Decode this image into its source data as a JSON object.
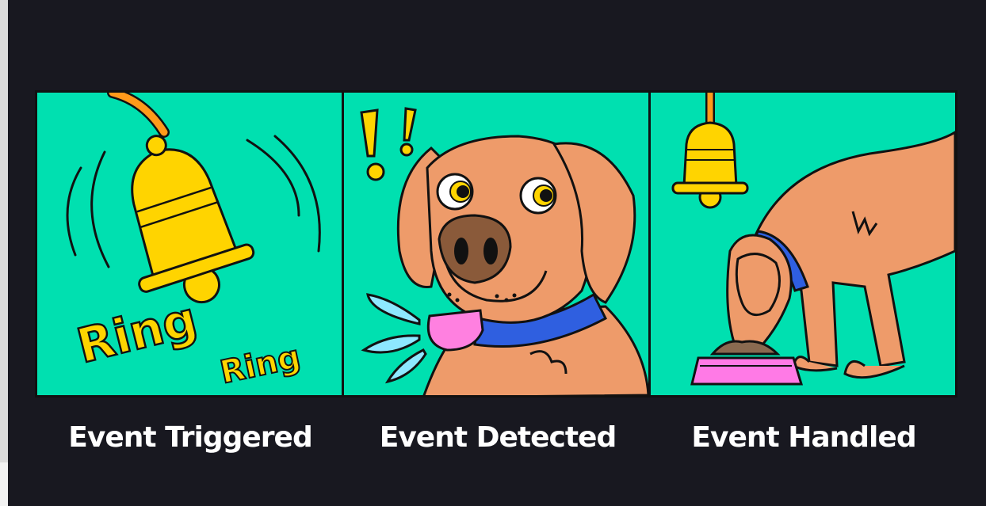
{
  "panels": [
    {
      "id": "event-triggered",
      "caption": "Event Triggered",
      "sound_text": [
        "Ring",
        "Ring"
      ]
    },
    {
      "id": "event-detected",
      "caption": "Event Detected",
      "exclamation": "! !"
    },
    {
      "id": "event-handled",
      "caption": "Event Handled"
    }
  ],
  "colors": {
    "background": "#181820",
    "panel": "#00e0b0",
    "outline": "#111111",
    "bell": "#ffd400",
    "bell_cord": "#ff9a1a",
    "dog": "#ee9b6a",
    "collar": "#2f5fe0",
    "tongue": "#ff80e0",
    "bowl": "#ff7ae6",
    "drool": "#8de8ff",
    "caption": "#ffffff"
  }
}
